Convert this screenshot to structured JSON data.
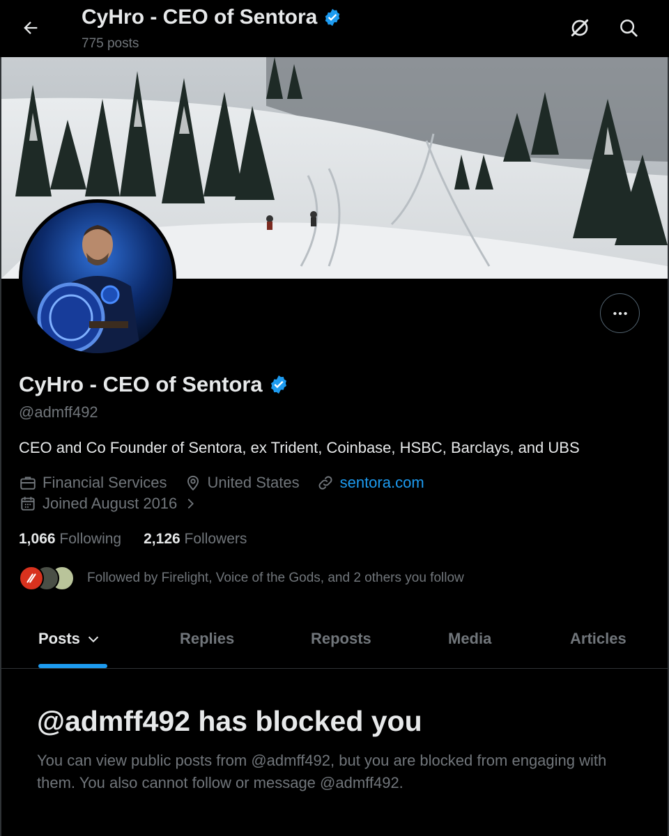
{
  "header": {
    "title": "CyHro - CEO of Sentora",
    "posts_count": "775 posts",
    "icons": [
      "arrow-left-icon",
      "grok-icon",
      "search-icon"
    ]
  },
  "profile": {
    "name": "CyHro - CEO of Sentora",
    "verified": true,
    "handle": "@admff492",
    "bio": "CEO and Co Founder of Sentora, ex Trident, Coinbase, HSBC, Barclays, and UBS",
    "category": "Financial Services",
    "location": "United States",
    "website": "sentora.com",
    "joined": "Joined August 2016",
    "following_count": "1,066",
    "following_label": "Following",
    "followers_count": "2,126",
    "followers_label": "Followers",
    "followed_by": "Followed by Firelight, Voice of the Gods, and 2 others you follow"
  },
  "tabs": [
    {
      "label": "Posts",
      "active": true
    },
    {
      "label": "Replies",
      "active": false
    },
    {
      "label": "Reposts",
      "active": false
    },
    {
      "label": "Media",
      "active": false
    },
    {
      "label": "Articles",
      "active": false
    }
  ],
  "blocked": {
    "title": "@admff492 has blocked you",
    "body": "You can view public posts from @admff492, but you are blocked from engaging with them. You also cannot follow or message @admff492."
  },
  "colors": {
    "background": "#000000",
    "text": "#e7e9ea",
    "muted": "#71767b",
    "accent": "#1d9bf0"
  }
}
